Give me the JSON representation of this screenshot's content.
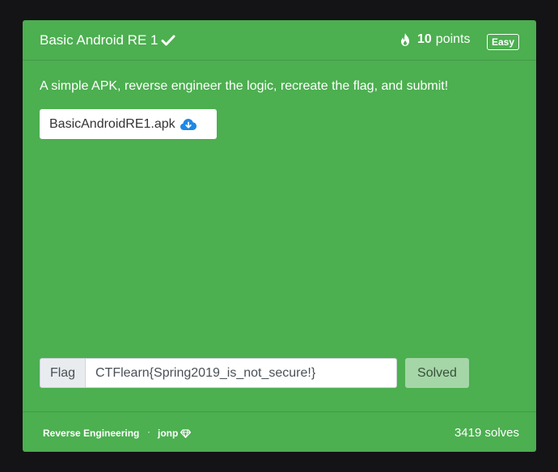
{
  "challenge": {
    "title": "Basic Android RE 1",
    "points_value": "10",
    "points_label": "points",
    "difficulty": "Easy",
    "description": "A simple APK, reverse engineer the logic, recreate the flag, and submit!",
    "file_name": "BasicAndroidRE1.apk"
  },
  "flag_form": {
    "label": "Flag",
    "value": "CTFlearn{Spring2019_is_not_secure!}",
    "submit_label": "Solved"
  },
  "footer": {
    "category": "Reverse Engineering",
    "separator": "·",
    "author": "jonp",
    "solves": "3419 solves"
  },
  "colors": {
    "card_bg": "#4caf50",
    "page_bg": "#141416",
    "download_icon": "#1e88e5",
    "solved_button": "#a5d6a7"
  },
  "icons": {
    "solved": "check-icon",
    "points": "fire-icon",
    "download": "cloud-download-icon",
    "author_badge": "diamond-icon"
  }
}
